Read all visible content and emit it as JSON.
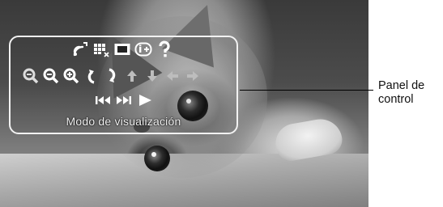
{
  "panel": {
    "mode_caption": "Modo de visualización",
    "row1_icons": [
      "wireless-signal-icon",
      "settings-grid-icon",
      "screen-mode-icon",
      "info-icon",
      "help-icon"
    ],
    "row2_icons": [
      "zoom-out-small-icon",
      "zoom-out-icon",
      "zoom-in-icon",
      "rotate-left-icon",
      "rotate-right-icon",
      "arrow-up-icon",
      "arrow-down-icon",
      "arrow-left-icon",
      "arrow-right-icon"
    ],
    "row3_icons": [
      "skip-previous-icon",
      "skip-next-icon",
      "play-icon"
    ]
  },
  "callout": {
    "line1": "Panel de",
    "line2": "control"
  },
  "colors": {
    "icon_active": "#ffffff",
    "icon_dim": "#c8c8c8",
    "frame": "#f2f2f2"
  }
}
